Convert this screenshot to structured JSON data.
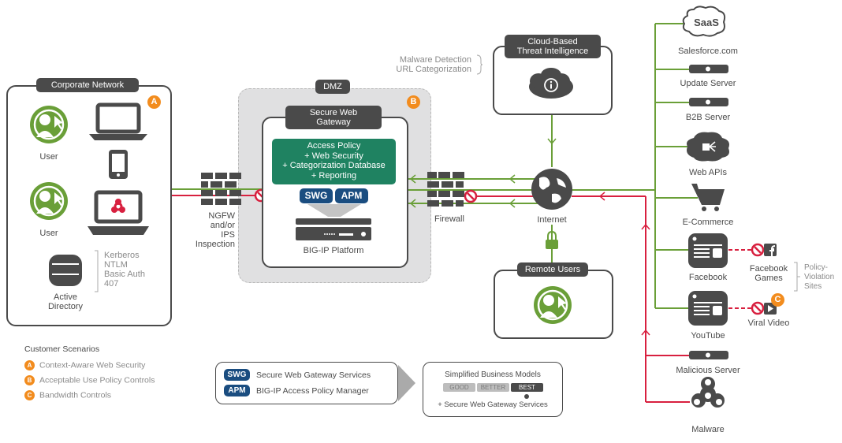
{
  "colors": {
    "accent_green": "#6a9f38",
    "threat_red": "#d8203f",
    "dark_gray": "#4a4a4a",
    "policy_green": "#1f8261",
    "pill_blue": "#1a4d80",
    "scenario_orange": "#f28c1e",
    "dmz_fill": "#e0e0e1"
  },
  "corporate": {
    "title": "Corporate Network",
    "badge": "A",
    "user1": "User",
    "user2": "User",
    "directory": "Active Directory",
    "directory_line1": "Active",
    "directory_line2": "Directory",
    "auth_methods": [
      "Kerberos",
      "NTLM",
      "Basic Auth",
      "407"
    ],
    "icons": [
      "user-icon",
      "laptop-icon",
      "phone-icon",
      "infected-laptop-icon",
      "database-icon"
    ]
  },
  "ngfw": {
    "lines": [
      "NGFW",
      "and/or",
      "IPS",
      "Inspection"
    ]
  },
  "dmz": {
    "title": "DMZ",
    "badge": "B",
    "swg_title_line1": "Secure Web",
    "swg_title_line2": "Gateway",
    "policy_lines": [
      "Access Policy",
      "+ Web Security",
      "+ Categorization Database",
      "+ Reporting"
    ],
    "pill_swg": "SWG",
    "pill_apm": "APM",
    "platform": "BIG-IP Platform"
  },
  "firewall": {
    "label": "Firewall"
  },
  "cloud": {
    "title_line1": "Cloud-Based",
    "title_line2": "Threat Intelligence",
    "features": [
      "Malware Detection",
      "URL Categorization"
    ]
  },
  "internet": {
    "label": "Internet"
  },
  "remote": {
    "title": "Remote Users"
  },
  "destinations": {
    "saas_icon_text": "SaaS",
    "salesforce": "Salesforce.com",
    "update_server": "Update Server",
    "b2b_server": "B2B Server",
    "web_apis": "Web APIs",
    "ecommerce": "E-Commerce",
    "facebook": "Facebook",
    "facebook_games_line1": "Facebook",
    "facebook_games_line2": "Games",
    "youtube": "YouTube",
    "viral_video": "Viral Video",
    "viral_badge": "C",
    "policy_violation": [
      "Policy-",
      "Violation",
      "Sites"
    ],
    "malicious_server": "Malicious Server",
    "malware": "Malware"
  },
  "legend": {
    "title": "Customer Scenarios",
    "items": [
      {
        "badge": "A",
        "label": "Context-Aware Web Security"
      },
      {
        "badge": "B",
        "label": "Acceptable Use Policy Controls"
      },
      {
        "badge": "C",
        "label": "Bandwidth Controls"
      }
    ]
  },
  "services": {
    "items": [
      {
        "pill": "SWG",
        "label": "Secure Web Gateway Services"
      },
      {
        "pill": "APM",
        "label": "BIG-IP Access Policy Manager"
      }
    ]
  },
  "business": {
    "title": "Simplified Business Models",
    "tiers": [
      "GOOD",
      "BETTER",
      "BEST"
    ],
    "selected": "BEST",
    "footer": "+ Secure Web Gateway Services"
  }
}
